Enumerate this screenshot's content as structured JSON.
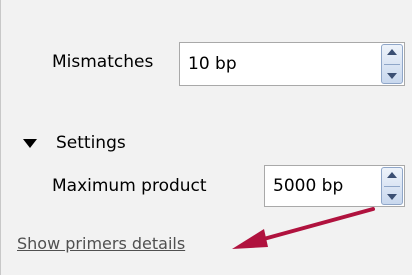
{
  "primer_settings": {
    "mismatches": {
      "label": "Mismatches",
      "value": "10 bp"
    },
    "settings_section": {
      "title": "Settings",
      "expanded": true
    },
    "maximum_product": {
      "label": "Maximum product",
      "value": "5000 bp"
    },
    "show_details_link": "Show primers details"
  },
  "annotation": {
    "arrow_color": "#b0123e"
  },
  "icons": {
    "spin_up": "spin-up-arrow-icon",
    "spin_down": "spin-down-arrow-icon",
    "collapse": "triangle-down-icon"
  }
}
